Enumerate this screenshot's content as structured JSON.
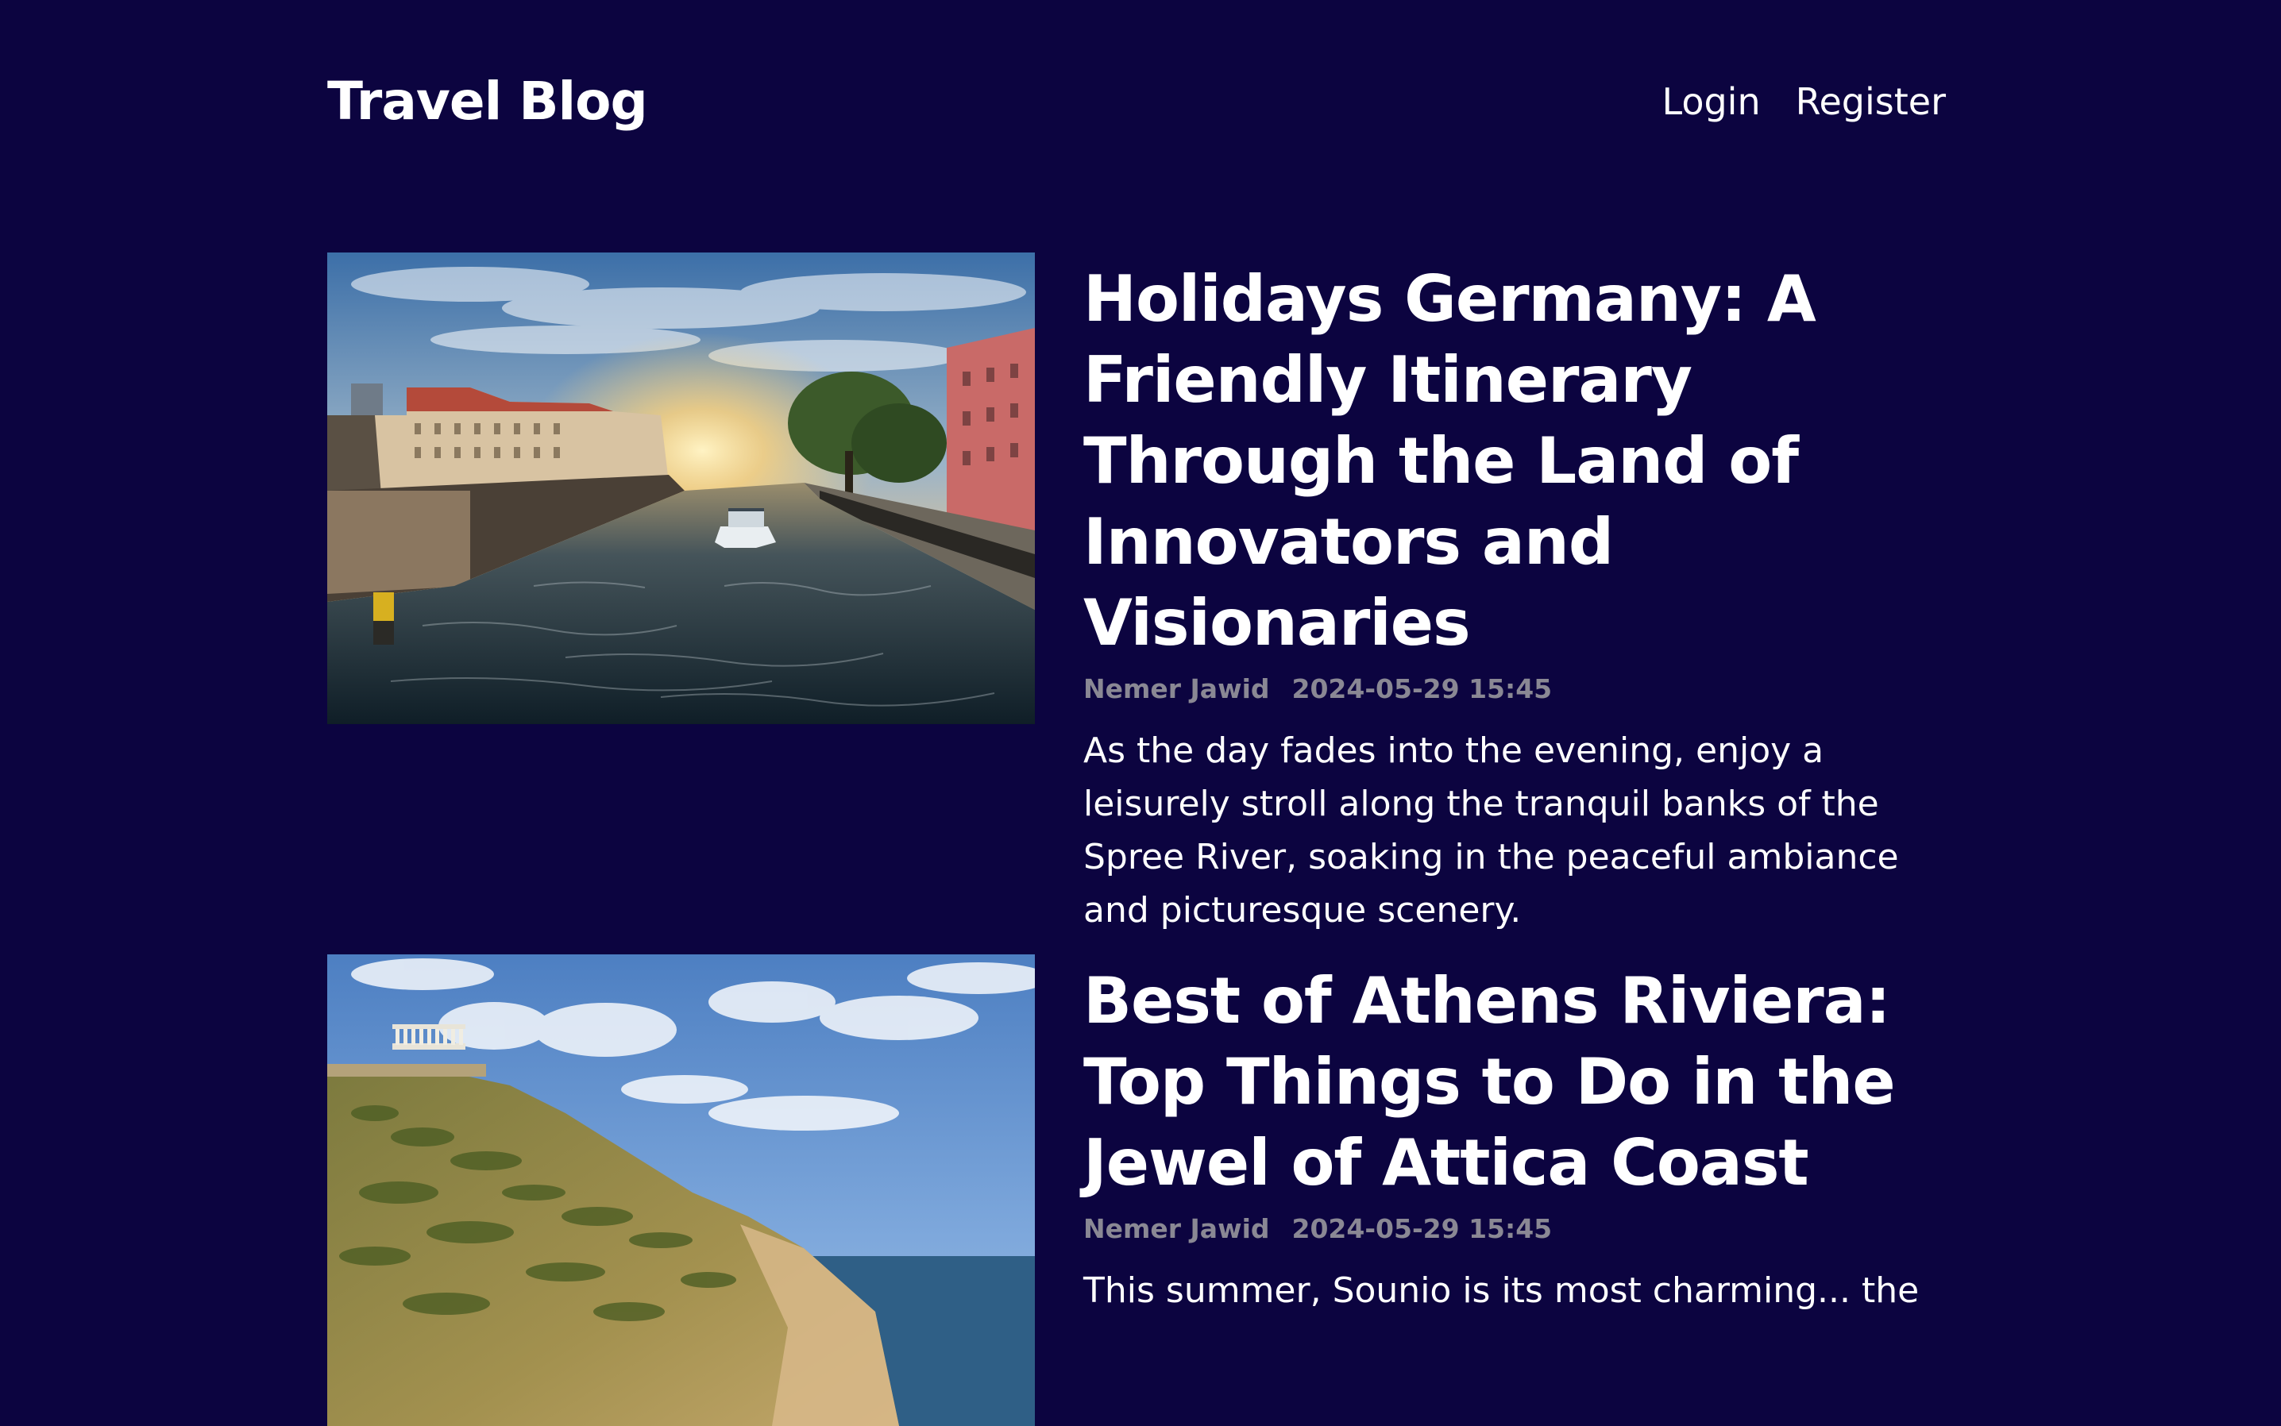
{
  "header": {
    "brand": "Travel Blog",
    "nav": {
      "login": "Login",
      "register": "Register"
    }
  },
  "posts": [
    {
      "title": "Holidays Germany: A Friendly Itinerary Through the Land of Innovators and Visionaries",
      "author": "Nemer Jawid",
      "date": "2024-05-29 15:45",
      "excerpt": "As the day fades into the evening, enjoy a leisurely stroll along the tranquil banks of the Spree River, soaking in the peaceful ambiance and picturesque scenery."
    },
    {
      "title": "Best of Athens Riviera: Top Things to Do in the Jewel of Attica Coast",
      "author": "Nemer Jawid",
      "date": "2024-05-29 15:45",
      "excerpt": "This summer, Sounio is its most charming... the"
    }
  ]
}
